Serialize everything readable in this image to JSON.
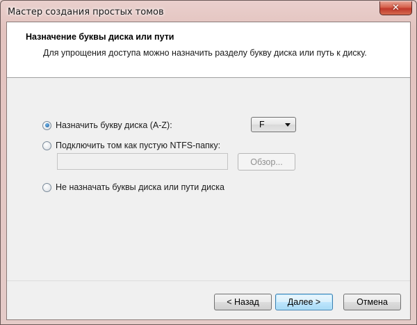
{
  "window": {
    "title": "Мастер создания простых томов",
    "close_label": "✕"
  },
  "header": {
    "title": "Назначение буквы диска или пути",
    "subtitle": "Для упрощения доступа можно назначить разделу букву диска или путь к диску."
  },
  "options": [
    {
      "label": "Назначить букву диска (A-Z):",
      "checked": true
    },
    {
      "label": "Подключить том как пустую NTFS-папку:",
      "checked": false
    },
    {
      "label": "Не назначать буквы диска или пути диска",
      "checked": false
    }
  ],
  "drive_letter": {
    "selected": "F"
  },
  "folder_path": {
    "value": ""
  },
  "browse_label": "Обзор...",
  "buttons": {
    "back": "< Назад",
    "next": "Далее >",
    "cancel": "Отмена"
  }
}
